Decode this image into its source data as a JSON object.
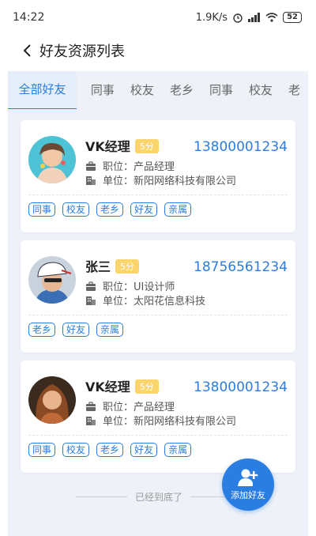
{
  "status_bar": {
    "time": "14:22",
    "speed": "1.9K/s",
    "battery": "52"
  },
  "nav": {
    "title": "好友资源列表"
  },
  "tabs": [
    {
      "label": "全部好友"
    },
    {
      "label": "同事"
    },
    {
      "label": "校友"
    },
    {
      "label": "老乡"
    },
    {
      "label": "同事"
    },
    {
      "label": "校友"
    },
    {
      "label": "老"
    }
  ],
  "cards": [
    {
      "name": "VK经理",
      "score": "5分",
      "phone": "13800001234",
      "position_label": "职位：",
      "position": "产品经理",
      "company_label": "单位：",
      "company": "新阳网络科技有限公司",
      "tags": [
        "同事",
        "校友",
        "老乡",
        "好友",
        "亲属"
      ]
    },
    {
      "name": "张三",
      "score": "5分",
      "phone": "18756561234",
      "position_label": "职位：",
      "position": "UI设计师",
      "company_label": "单位：",
      "company": "太阳花信息科技",
      "tags": [
        "老乡",
        "好友",
        "亲属"
      ]
    },
    {
      "name": "VK经理",
      "score": "5分",
      "phone": "13800001234",
      "position_label": "职位：",
      "position": "产品经理",
      "company_label": "单位：",
      "company": "新阳网络科技有限公司",
      "tags": [
        "同事",
        "校友",
        "老乡",
        "好友",
        "亲属"
      ]
    }
  ],
  "footer": {
    "end_text": "已经到底了"
  },
  "fab": {
    "label": "添加好友"
  },
  "colors": {
    "accent": "#2a7de1",
    "badge": "#fbd46b",
    "background": "#eef2f8"
  }
}
